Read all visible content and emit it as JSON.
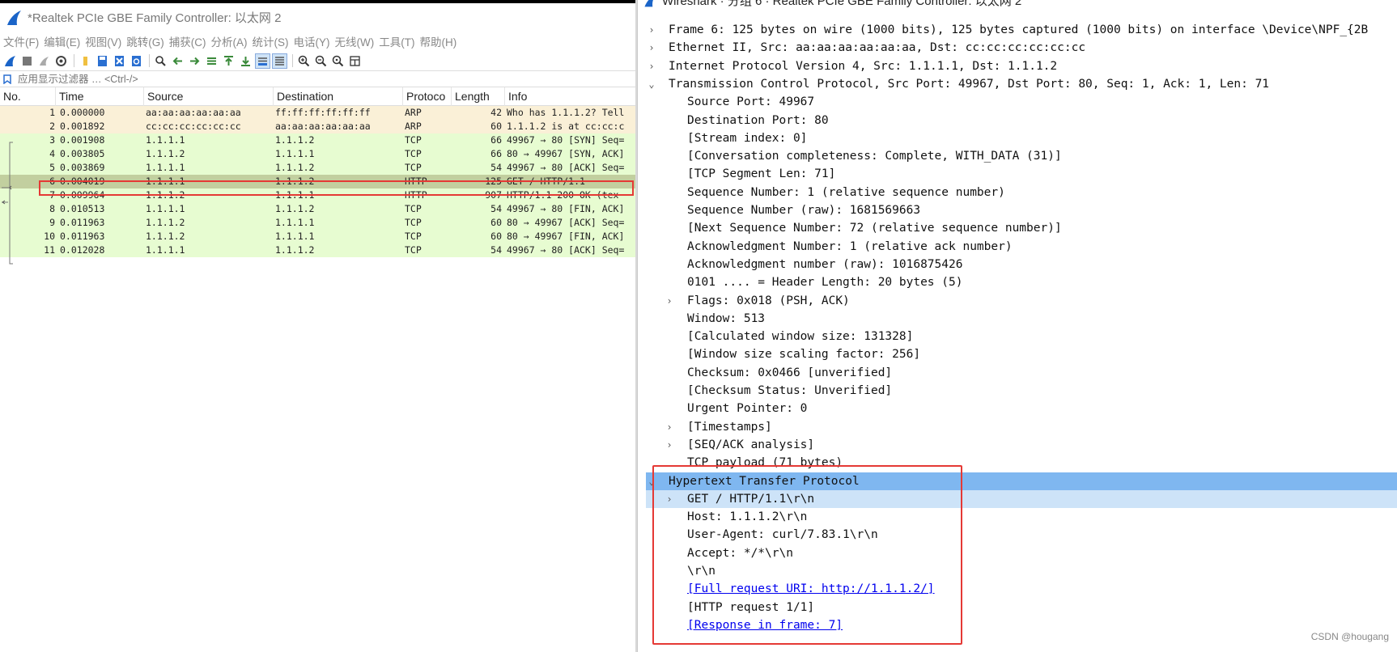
{
  "left": {
    "title": "*Realtek PCIe GBE Family Controller: 以太网 2",
    "menu": [
      "文件(F)",
      "编辑(E)",
      "视图(V)",
      "跳转(G)",
      "捕获(C)",
      "分析(A)",
      "统计(S)",
      "电话(Y)",
      "无线(W)",
      "工具(T)",
      "帮助(H)"
    ],
    "filter_placeholder": "应用显示过滤器 … <Ctrl-/>",
    "columns": [
      "No.",
      "Time",
      "Source",
      "Destination",
      "Protoco",
      "Length",
      "Info"
    ],
    "packets": [
      {
        "no": "1",
        "time": "0.000000",
        "src": "aa:aa:aa:aa:aa:aa",
        "dst": "ff:ff:ff:ff:ff:ff",
        "proto": "ARP",
        "len": "42",
        "info": "Who has 1.1.1.2? Tell",
        "color": "#faf0d7"
      },
      {
        "no": "2",
        "time": "0.001892",
        "src": "cc:cc:cc:cc:cc:cc",
        "dst": "aa:aa:aa:aa:aa:aa",
        "proto": "ARP",
        "len": "60",
        "info": "1.1.1.2 is at cc:cc:c",
        "color": "#faf0d7"
      },
      {
        "no": "3",
        "time": "0.001908",
        "src": "1.1.1.1",
        "dst": "1.1.1.2",
        "proto": "TCP",
        "len": "66",
        "info": "49967 → 80 [SYN] Seq=",
        "color": "#e7fcd1"
      },
      {
        "no": "4",
        "time": "0.003805",
        "src": "1.1.1.2",
        "dst": "1.1.1.1",
        "proto": "TCP",
        "len": "66",
        "info": "80 → 49967 [SYN, ACK]",
        "color": "#e7fcd1"
      },
      {
        "no": "5",
        "time": "0.003869",
        "src": "1.1.1.1",
        "dst": "1.1.1.2",
        "proto": "TCP",
        "len": "54",
        "info": "49967 → 80 [ACK] Seq=",
        "color": "#e7fcd1"
      },
      {
        "no": "6",
        "time": "0.004019",
        "src": "1.1.1.1",
        "dst": "1.1.1.2",
        "proto": "HTTP",
        "len": "125",
        "info": "GET / HTTP/1.1",
        "color": "#c2cf9f"
      },
      {
        "no": "7",
        "time": "0.009964",
        "src": "1.1.1.2",
        "dst": "1.1.1.1",
        "proto": "HTTP",
        "len": "907",
        "info": "HTTP/1.1 200 OK  (tex",
        "color": "#e7fcd1"
      },
      {
        "no": "8",
        "time": "0.010513",
        "src": "1.1.1.1",
        "dst": "1.1.1.2",
        "proto": "TCP",
        "len": "54",
        "info": "49967 → 80 [FIN, ACK]",
        "color": "#e7fcd1"
      },
      {
        "no": "9",
        "time": "0.011963",
        "src": "1.1.1.2",
        "dst": "1.1.1.1",
        "proto": "TCP",
        "len": "60",
        "info": "80 → 49967 [ACK] Seq=",
        "color": "#e7fcd1"
      },
      {
        "no": "10",
        "time": "0.011963",
        "src": "1.1.1.2",
        "dst": "1.1.1.1",
        "proto": "TCP",
        "len": "60",
        "info": "80 → 49967 [FIN, ACK]",
        "color": "#e7fcd1"
      },
      {
        "no": "11",
        "time": "0.012028",
        "src": "1.1.1.1",
        "dst": "1.1.1.2",
        "proto": "TCP",
        "len": "54",
        "info": "49967 → 80 [ACK] Seq=",
        "color": "#e7fcd1"
      }
    ]
  },
  "right": {
    "title": "Wireshark · 分组 6 · Realtek PCIe GBE Family Controller: 以太网 2",
    "tree": [
      {
        "level": 0,
        "arrow": "›",
        "text": "Frame 6: 125 bytes on wire (1000 bits), 125 bytes captured (1000 bits) on interface \\Device\\NPF_{2B"
      },
      {
        "level": 0,
        "arrow": "›",
        "text": "Ethernet II, Src: aa:aa:aa:aa:aa:aa, Dst: cc:cc:cc:cc:cc:cc"
      },
      {
        "level": 0,
        "arrow": "›",
        "text": "Internet Protocol Version 4, Src: 1.1.1.1, Dst: 1.1.1.2"
      },
      {
        "level": 0,
        "arrow": "⌄",
        "text": "Transmission Control Protocol, Src Port: 49967, Dst Port: 80, Seq: 1, Ack: 1, Len: 71"
      },
      {
        "level": 1,
        "arrow": "",
        "text": "Source Port: 49967"
      },
      {
        "level": 1,
        "arrow": "",
        "text": "Destination Port: 80"
      },
      {
        "level": 1,
        "arrow": "",
        "text": "[Stream index: 0]"
      },
      {
        "level": 1,
        "arrow": "",
        "text": "[Conversation completeness: Complete, WITH_DATA (31)]"
      },
      {
        "level": 1,
        "arrow": "",
        "text": "[TCP Segment Len: 71]"
      },
      {
        "level": 1,
        "arrow": "",
        "text": "Sequence Number: 1    (relative sequence number)"
      },
      {
        "level": 1,
        "arrow": "",
        "text": "Sequence Number (raw): 1681569663"
      },
      {
        "level": 1,
        "arrow": "",
        "text": "[Next Sequence Number: 72    (relative sequence number)]"
      },
      {
        "level": 1,
        "arrow": "",
        "text": "Acknowledgment Number: 1    (relative ack number)"
      },
      {
        "level": 1,
        "arrow": "",
        "text": "Acknowledgment number (raw): 1016875426"
      },
      {
        "level": 1,
        "arrow": "",
        "text": "0101 .... = Header Length: 20 bytes (5)"
      },
      {
        "level": 1,
        "arrow": "›",
        "text": "Flags: 0x018 (PSH, ACK)"
      },
      {
        "level": 1,
        "arrow": "",
        "text": "Window: 513"
      },
      {
        "level": 1,
        "arrow": "",
        "text": "[Calculated window size: 131328]"
      },
      {
        "level": 1,
        "arrow": "",
        "text": "[Window size scaling factor: 256]"
      },
      {
        "level": 1,
        "arrow": "",
        "text": "Checksum: 0x0466 [unverified]"
      },
      {
        "level": 1,
        "arrow": "",
        "text": "[Checksum Status: Unverified]"
      },
      {
        "level": 1,
        "arrow": "",
        "text": "Urgent Pointer: 0"
      },
      {
        "level": 1,
        "arrow": "›",
        "text": "[Timestamps]"
      },
      {
        "level": 1,
        "arrow": "›",
        "text": "[SEQ/ACK analysis]"
      },
      {
        "level": 1,
        "arrow": "",
        "text": "TCP payload (71 bytes)"
      },
      {
        "level": 0,
        "arrow": "⌄",
        "text": "Hypertext Transfer Protocol",
        "highlight": "main"
      },
      {
        "level": 1,
        "arrow": "›",
        "text": "GET / HTTP/1.1\\r\\n",
        "highlight": "sub"
      },
      {
        "level": 1,
        "arrow": "",
        "text": "Host: 1.1.1.2\\r\\n"
      },
      {
        "level": 1,
        "arrow": "",
        "text": "User-Agent: curl/7.83.1\\r\\n"
      },
      {
        "level": 1,
        "arrow": "",
        "text": "Accept: */*\\r\\n"
      },
      {
        "level": 1,
        "arrow": "",
        "text": "\\r\\n"
      },
      {
        "level": 1,
        "arrow": "",
        "text": "[Full request URI: http://1.1.1.2/]",
        "link": true
      },
      {
        "level": 1,
        "arrow": "",
        "text": "[HTTP request 1/1]"
      },
      {
        "level": 1,
        "arrow": "",
        "text": "[Response in frame: 7]",
        "link": true
      }
    ]
  },
  "watermark": "CSDN @hougang",
  "colors": {
    "selection_box": "#e53935",
    "http_highlight": "#7fb7f0",
    "get_highlight": "#cde3f8",
    "arp_row": "#faf0d7",
    "tcp_row": "#e7fcd1",
    "selected_row": "#c2cf9f"
  }
}
